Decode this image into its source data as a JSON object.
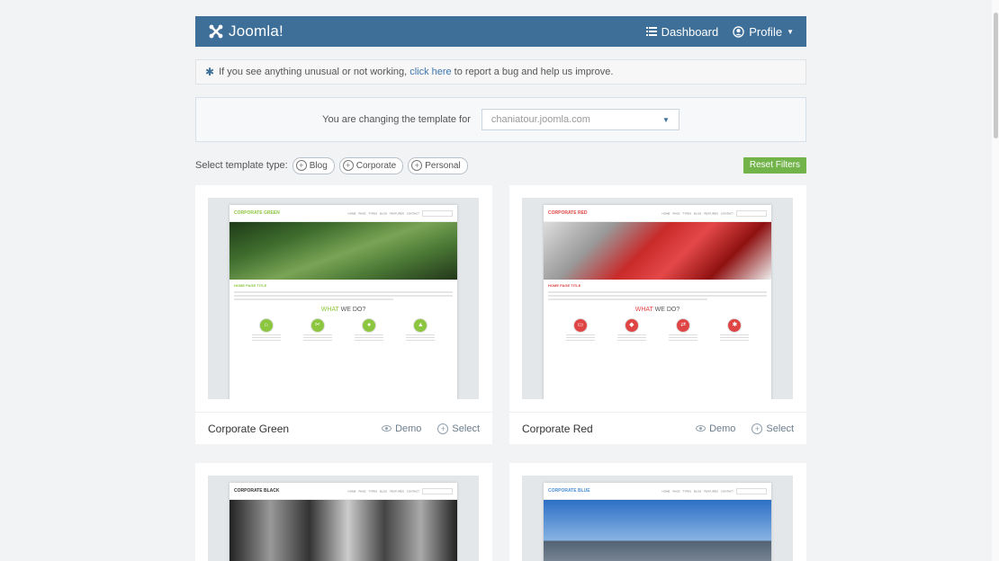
{
  "topbar": {
    "brand": "Joomla!",
    "nav": {
      "dashboard": "Dashboard",
      "profile": "Profile"
    }
  },
  "notice": {
    "before": "If you see anything unusual or not working,",
    "link": "click here",
    "after": "to report a bug and help us improve."
  },
  "changer": {
    "label": "You are changing the template for",
    "site": "chaniatour.joomla.com"
  },
  "filters": {
    "label": "Select template type:",
    "types": [
      "Blog",
      "Corporate",
      "Personal"
    ],
    "reset": "Reset Filters"
  },
  "cards": [
    {
      "title": "Corporate Green",
      "demo": "Demo",
      "select": "Select",
      "mock_logo": "CORPORATE GREEN",
      "accent": "#8cc63f"
    },
    {
      "title": "Corporate Red",
      "demo": "Demo",
      "select": "Select",
      "mock_logo": "CORPORATE RED",
      "accent": "#e04545"
    },
    {
      "mock_logo": "CORPORATE BLACK",
      "accent": "#333333"
    },
    {
      "mock_logo": "CORPORATE BLUE",
      "accent": "#4a8fd4"
    }
  ],
  "mock": {
    "nav": "HOME PAGE TYPES BLOG FEATURES CONTACT",
    "page_title": "HOME PAGE TITLE",
    "what_a": "WHAT",
    "what_b": "WE DO?"
  }
}
